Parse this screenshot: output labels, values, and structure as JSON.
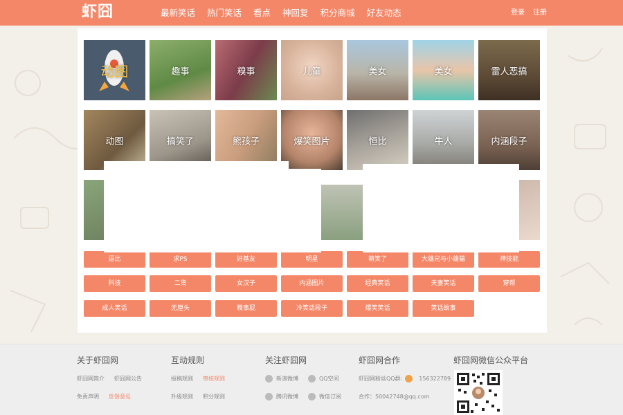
{
  "header": {
    "logo": "虾囧",
    "nav": [
      "最新笑话",
      "热门笑话",
      "看点",
      "神回复",
      "积分商城",
      "好友动态"
    ],
    "login": "登录",
    "register": "注册"
  },
  "categories_row1": [
    "动图",
    "趣事",
    "糗事",
    "儿童",
    "美女",
    "美女",
    "雷人恶搞"
  ],
  "categories_row2": [
    "动图",
    "搞笑了",
    "熊孩子",
    "爆笑图片",
    "恒比",
    "牛人",
    "内涵段子"
  ],
  "tags_row1": [
    "逗比",
    "求PS",
    "好基友",
    "明星",
    "萌笑了",
    "大雄兄与小雄猫",
    "神技能"
  ],
  "tags_row2": [
    "科技",
    "二货",
    "女汉子",
    "内涵图片",
    "经典笑话",
    "夫妻笑话",
    "穿帮"
  ],
  "tags_row3": [
    "成人笑话",
    "无厘头",
    "糗事屁",
    "冷笑话段子",
    "爆笑笑话",
    "笑话故事"
  ],
  "footer": {
    "about": {
      "title": "关于虾囧网",
      "links": [
        "虾囧网简介",
        "虾囧网公告",
        "免责声明",
        "反馈意见"
      ]
    },
    "rules": {
      "title": "互动规则",
      "links": [
        "投稿规则",
        "审核规则",
        "升级规则",
        "积分规则"
      ]
    },
    "follow": {
      "title": "关注虾囧网",
      "links": [
        "新浪微博",
        "QQ空间",
        "腾讯微博",
        "微信订阅"
      ]
    },
    "cooperate": {
      "title": "虾囧网合作",
      "qq_group_label": "虾囧网粉丝QQ群:",
      "qq_group": "156322789",
      "contact": "合作：50042748@qq.com"
    },
    "wechat": {
      "title": "虾囧网微信公众平台"
    }
  },
  "colors": {
    "accent": "#f48768",
    "footer_bg": "#eeeeee"
  }
}
